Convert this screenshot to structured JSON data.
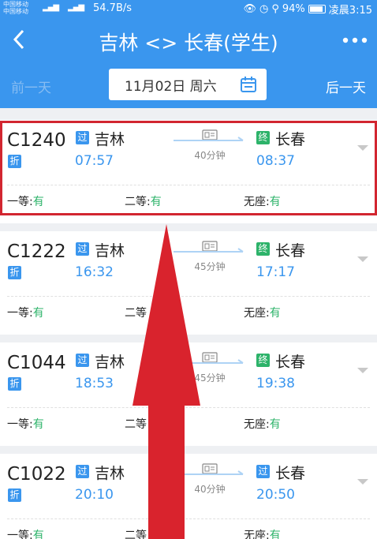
{
  "status_bar": {
    "carrier1": "中国移动",
    "carrier2": "中国移动",
    "signal1": "4G",
    "signal2": "4G",
    "net_speed": "54.7B/s",
    "battery": "94%",
    "time": "凌晨3:15"
  },
  "header": {
    "title": "吉林 <> 长春(学生)"
  },
  "date_bar": {
    "prev": "前一天",
    "date": "11月02日 周六",
    "next": "后一天"
  },
  "trains": [
    {
      "number": "C1240",
      "discount": "折",
      "from_badge": "过",
      "from": "吉林",
      "dep": "07:57",
      "duration": "40分钟",
      "to_badge": "终",
      "to": "长春",
      "arr": "08:37",
      "seats": [
        {
          "label": "一等:",
          "value": "有"
        },
        {
          "label": "二等:",
          "value": "有"
        },
        {
          "label": "无座:",
          "value": "有"
        }
      ]
    },
    {
      "number": "C1222",
      "discount": "折",
      "from_badge": "过",
      "from": "吉林",
      "dep": "16:32",
      "duration": "45分钟",
      "to_badge": "终",
      "to": "长春",
      "arr": "17:17",
      "seats": [
        {
          "label": "一等:",
          "value": "有"
        },
        {
          "label": "二等",
          "value": ""
        },
        {
          "label": "无座:",
          "value": "有"
        }
      ]
    },
    {
      "number": "C1044",
      "discount": "折",
      "from_badge": "过",
      "from": "吉林",
      "dep": "18:53",
      "duration": "45分钟",
      "to_badge": "终",
      "to": "长春",
      "arr": "19:38",
      "seats": [
        {
          "label": "一等:",
          "value": "有"
        },
        {
          "label": "二等",
          "value": ""
        },
        {
          "label": "无座:",
          "value": "有"
        }
      ]
    },
    {
      "number": "C1022",
      "discount": "折",
      "from_badge": "过",
      "from": "吉林",
      "dep": "20:10",
      "duration": "40分钟",
      "to_badge": "过",
      "to": "长春",
      "arr": "20:50",
      "seats": [
        {
          "label": "一等:",
          "value": "有"
        },
        {
          "label": "二等",
          "value": ""
        },
        {
          "label": "无座:",
          "value": "有"
        }
      ]
    }
  ],
  "colors": {
    "brand": "#3a96ee",
    "available": "#2db36a",
    "highlight": "#d22630",
    "arrow": "#d22630"
  }
}
